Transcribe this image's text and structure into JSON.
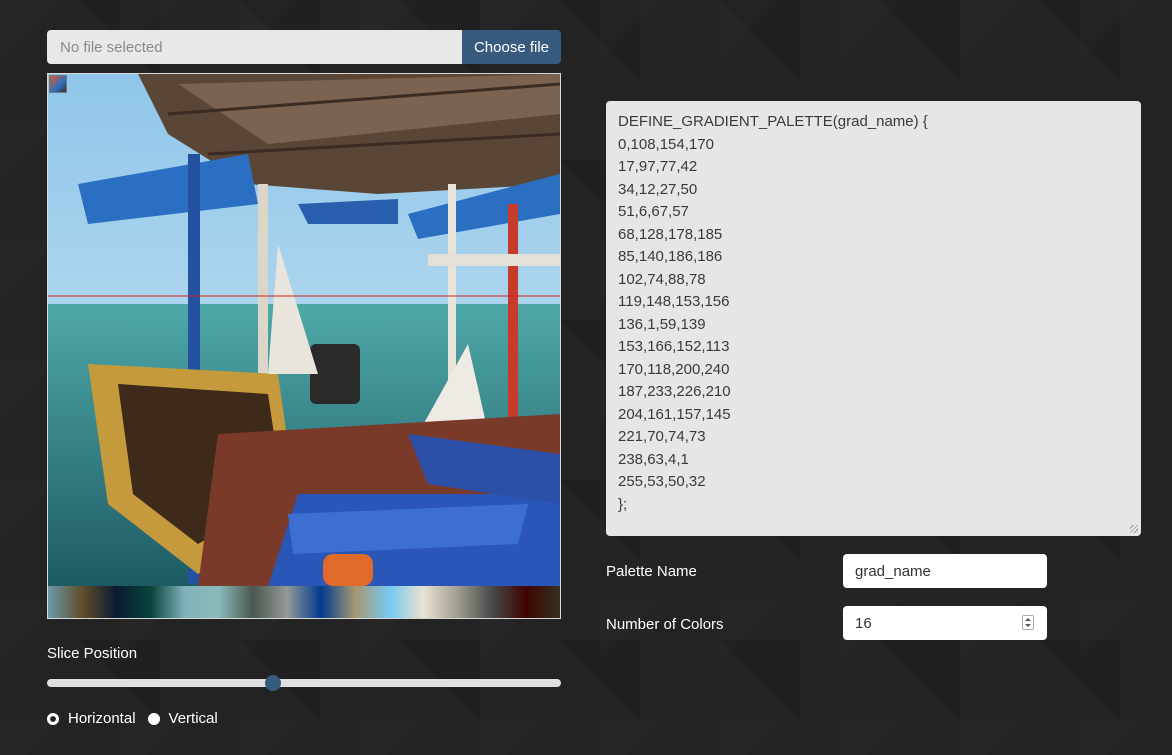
{
  "file_input": {
    "placeholder": "No file selected",
    "button_label": "Choose file"
  },
  "image_preview": {
    "description_icon": "photo-image",
    "slice_line_color": "#d2231f",
    "gradient_colors": [
      "#6c9aaa",
      "#614d2a",
      "#0c1b32",
      "#064339",
      "#80b2b9",
      "#8cbaba",
      "#4a584e",
      "#949999",
      "#013b8b",
      "#a69871",
      "#76c8f0",
      "#e9e2d2",
      "#a19d91",
      "#464a49",
      "#3f0401",
      "#353220"
    ]
  },
  "slice": {
    "label": "Slice Position",
    "value_fraction": 0.44
  },
  "orientation": {
    "options": [
      {
        "label": "Horizontal",
        "checked": true
      },
      {
        "label": "Vertical",
        "checked": false
      }
    ]
  },
  "output": {
    "lines": [
      "DEFINE_GRADIENT_PALETTE(grad_name) {",
      "0,108,154,170",
      "17,97,77,42",
      "34,12,27,50",
      "51,6,67,57",
      "68,128,178,185",
      "85,140,186,186",
      "102,74,88,78",
      "119,148,153,156",
      "136,1,59,139",
      "153,166,152,113",
      "170,118,200,240",
      "187,233,226,210",
      "204,161,157,145",
      "221,70,74,73",
      "238,63,4,1",
      "255,53,50,32",
      "};"
    ]
  },
  "palette_name": {
    "label": "Palette Name",
    "value": "grad_name"
  },
  "num_colors": {
    "label": "Number of Colors",
    "value": "16"
  },
  "colors": {
    "background": "#232323",
    "accent": "#375a7f"
  }
}
